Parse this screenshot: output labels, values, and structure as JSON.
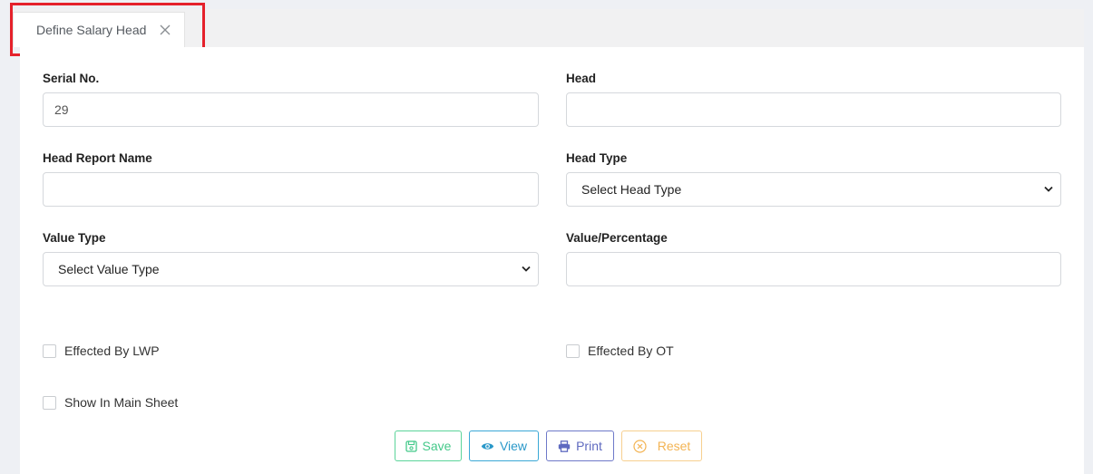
{
  "tab": {
    "label": "Define Salary Head",
    "close_icon": "close-icon"
  },
  "form": {
    "serial_no": {
      "label": "Serial No.",
      "value": "29"
    },
    "head": {
      "label": "Head",
      "value": ""
    },
    "head_report_name": {
      "label": "Head Report Name",
      "value": ""
    },
    "head_type": {
      "label": "Head Type",
      "selected": "Select Head Type"
    },
    "value_type": {
      "label": "Value Type",
      "selected": "Select Value Type"
    },
    "value_percentage": {
      "label": "Value/Percentage",
      "value": ""
    },
    "checkboxes": {
      "lwp": "Effected By LWP",
      "ot": "Effected By OT",
      "main_sheet": "Show In Main Sheet"
    }
  },
  "buttons": {
    "save": "Save",
    "view": "View",
    "print": "Print",
    "reset": "Reset"
  },
  "colors": {
    "highlight": "#e5212b",
    "save": "#45c98a",
    "view": "#2a98c9",
    "print": "#5f6ac0",
    "reset": "#f3b454"
  }
}
